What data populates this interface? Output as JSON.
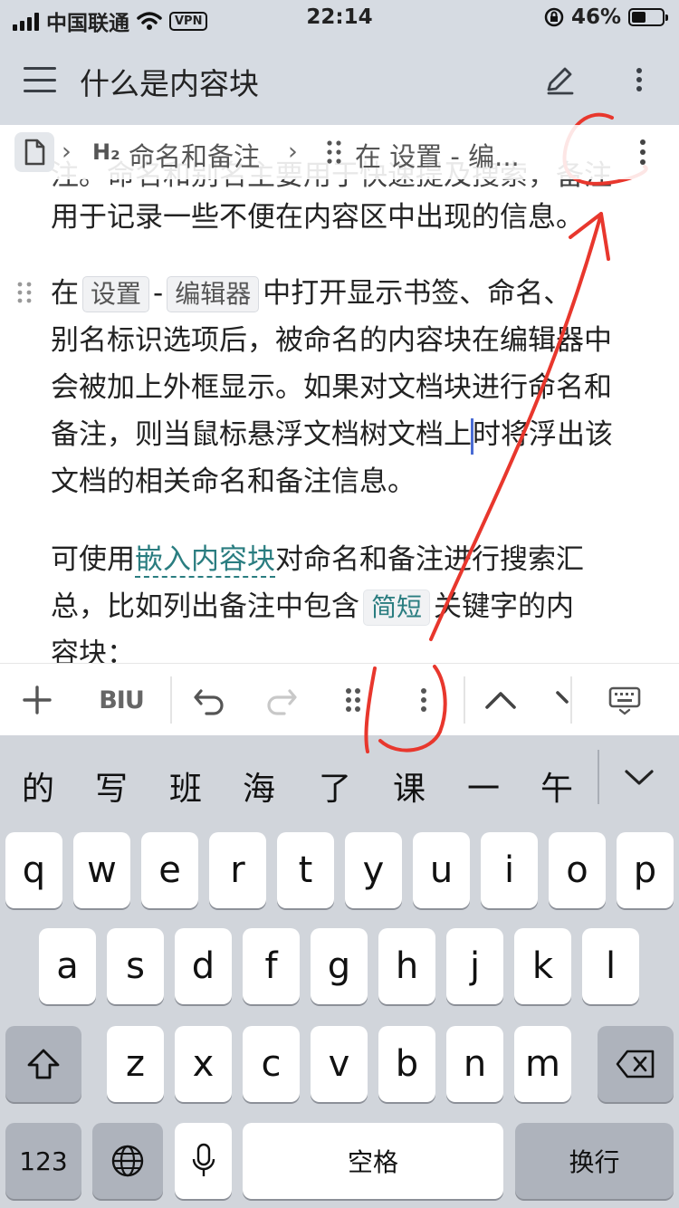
{
  "status_bar": {
    "carrier": "中国联通",
    "vpn": "VPN",
    "time": "22:14",
    "battery": "46%",
    "battery_level": 0.46
  },
  "header": {
    "title": "什么是内容块",
    "menu_icon": "hamburger-icon",
    "edit_icon": "pencil-icon",
    "more_icon": "more-vertical-icon"
  },
  "breadcrumb": {
    "heading_marker": "H₂",
    "heading": "命名和备注",
    "block": "在 设置 - 编..."
  },
  "content": {
    "line_partial": "注。命名和别名主要用于快速提及搜索，备注",
    "para1_end": "用于记录一些不便在内容区中出现的信息。",
    "para2": {
      "prefix": "在",
      "tag_settings": "设置",
      "dash": "-",
      "tag_editor": "编辑器",
      "line1_rest": "中打开显示书签、命名、",
      "line2": "别名标识选项后，被命名的内容块在编辑器中",
      "line3": "会被加上外框显示。如果对文档块进行命名和",
      "line4_a": "备注，则当鼠标悬浮文档树文档上",
      "line4_b": "时将浮出该",
      "line5": "文档的相关命名和备注信息。"
    },
    "para3": {
      "prefix": "可使用",
      "link": "嵌入内容块",
      "line1_rest": "对命名和备注进行搜索汇",
      "line2_a": "总，比如列出备注中包含",
      "tag": "简短",
      "line2_b": "关键字的内",
      "line3": "容块："
    }
  },
  "toolbar": {
    "format_label": "BIU",
    "icons": [
      "plus-icon",
      "format-icon",
      "undo-icon",
      "redo-icon",
      "drag-handle-icon",
      "more-vertical-icon",
      "chevron-up-icon",
      "chevron-right-icon",
      "keyboard-hide-icon"
    ]
  },
  "keyboard": {
    "candidates": [
      "的",
      "写",
      "班",
      "海",
      "了",
      "课",
      "一",
      "午"
    ],
    "row1": [
      "q",
      "w",
      "e",
      "r",
      "t",
      "y",
      "u",
      "i",
      "o",
      "p"
    ],
    "row2": [
      "a",
      "s",
      "d",
      "f",
      "g",
      "h",
      "j",
      "k",
      "l"
    ],
    "row3": [
      "z",
      "x",
      "c",
      "v",
      "b",
      "n",
      "m"
    ],
    "numbers": "123",
    "space": "空格",
    "return": "换行"
  },
  "annotation_color": "#e8372d"
}
